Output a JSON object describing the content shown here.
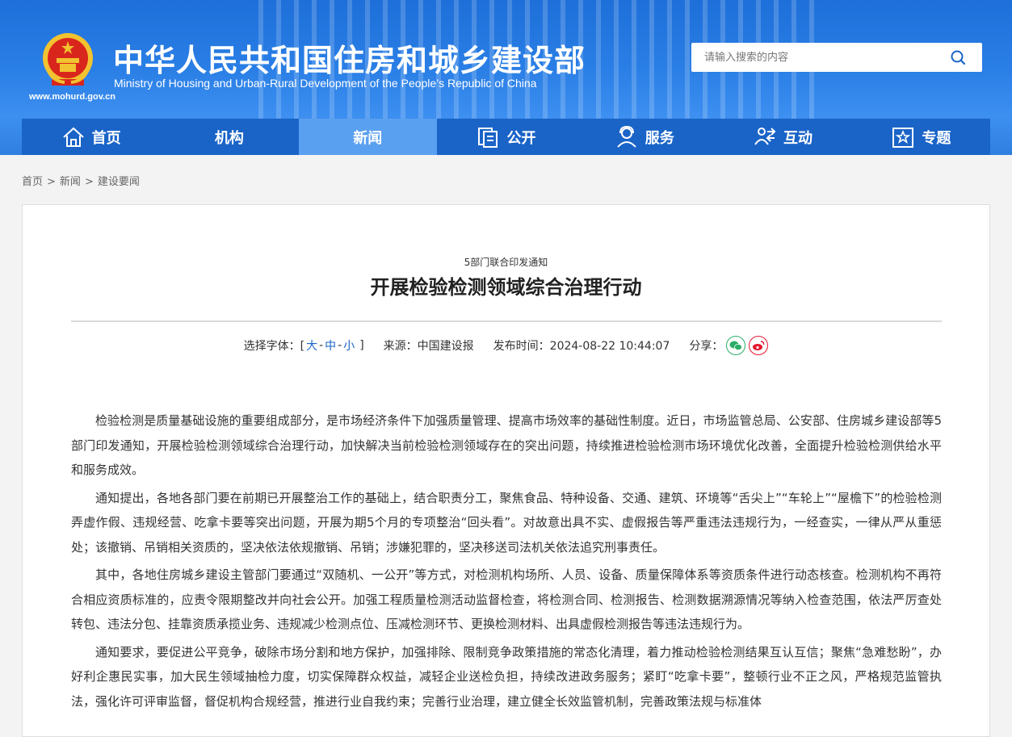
{
  "header": {
    "site_title": "中华人民共和国住房和城乡建设部",
    "site_subtitle": "Ministry of Housing and Urban-Rural Development of the People’s Republic of China",
    "site_url": "www.mohurd.gov.cn",
    "search_placeholder": "请输入搜索的内容"
  },
  "nav": {
    "items": [
      {
        "label": "首页",
        "icon": "home-icon"
      },
      {
        "label": "机构",
        "icon": ""
      },
      {
        "label": "新闻",
        "icon": "",
        "active": true
      },
      {
        "label": "公开",
        "icon": "document-icon"
      },
      {
        "label": "服务",
        "icon": "person-service-icon"
      },
      {
        "label": "互动",
        "icon": "interaction-icon"
      },
      {
        "label": "专题",
        "icon": "star-icon"
      }
    ]
  },
  "breadcrumb": {
    "items": [
      "首页",
      "新闻",
      "建设要闻"
    ],
    "separator": ">"
  },
  "article": {
    "kicker": "5部门联合印发通知",
    "title": "开展检验检测领域综合治理行动",
    "font_label": "选择字体：[",
    "font_large": "大",
    "font_medium": "中",
    "font_small": "小",
    "font_close": "]",
    "dash": "-",
    "source": "来源：中国建设报",
    "published": "发布时间：2024-08-22 10:44:07",
    "share_label": "分享：",
    "paragraphs": [
      "检验检测是质量基础设施的重要组成部分，是市场经济条件下加强质量管理、提高市场效率的基础性制度。近日，市场监管总局、公安部、住房城乡建设部等5部门印发通知，开展检验检测领域综合治理行动，加快解决当前检验检测领域存在的突出问题，持续推进检验检测市场环境优化改善，全面提升检验检测供给水平和服务成效。",
      "通知提出，各地各部门要在前期已开展整治工作的基础上，结合职责分工，聚焦食品、特种设备、交通、建筑、环境等“舌尖上”“车轮上”“屋檐下”的检验检测弄虚作假、违规经营、吃拿卡要等突出问题，开展为期5个月的专项整治“回头看”。对故意出具不实、虚假报告等严重违法违规行为，一经查实，一律从严从重惩处；该撤销、吊销相关资质的，坚决依法依规撤销、吊销；涉嫌犯罪的，坚决移送司法机关依法追究刑事责任。",
      "其中，各地住房城乡建设主管部门要通过“双随机、一公开”等方式，对检测机构场所、人员、设备、质量保障体系等资质条件进行动态核查。检测机构不再符合相应资质标准的，应责令限期整改并向社会公开。加强工程质量检测活动监督检查，将检测合同、检测报告、检测数据溯源情况等纳入检查范围，依法严厉查处转包、违法分包、挂靠资质承揽业务、违规减少检测点位、压减检测环节、更换检测材料、出具虚假检测报告等违法违规行为。",
      "通知要求，要促进公平竞争，破除市场分割和地方保护，加强排除、限制竞争政策措施的常态化清理，着力推动检验检测结果互认互信；聚焦“急难愁盼”，办好利企惠民实事，加大民生领域抽检力度，切实保障群众权益，减轻企业送检负担，持续改进政务服务；紧盯“吃拿卡要”，整顿行业不正之风，严格规范监管执法，强化许可评审监督，督促机构合规经营，推进行业自我约束；完善行业治理，建立健全长效监管机制，完善政策法规与标准体"
    ]
  },
  "colors": {
    "header_blue": "#2a7fe6",
    "nav_blue": "#1a64c8",
    "nav_active": "#5aa0f0",
    "link_blue": "#1a64c8",
    "wechat_green": "#2aae67",
    "weibo_red": "#e6162d"
  }
}
